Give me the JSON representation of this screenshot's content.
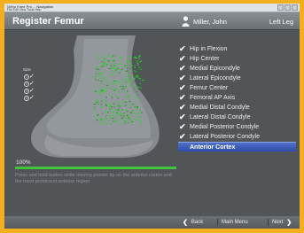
{
  "window": {
    "title": "Ortho Knee Pro ... Navigation",
    "menu": "File  Edit  View  Tools  Help"
  },
  "header": {
    "title": "Register Femur",
    "user": "Miller, John",
    "side": "Left Leg",
    "user_icon": "person-icon"
  },
  "size_panel": {
    "label": "Size",
    "items": [
      {
        "num": "1",
        "check": "✓"
      },
      {
        "num": "2",
        "check": "✓"
      },
      {
        "num": "3",
        "check": "✓"
      },
      {
        "num": "4",
        "check": "✓"
      }
    ]
  },
  "progress": {
    "label": "100%",
    "value": 100
  },
  "instructions": "Press and hold button while moving pointer tip on the anterior cortex and the most prominent anterior region.",
  "checklist": [
    {
      "label": "Hip in Flexion",
      "done": true
    },
    {
      "label": "Hip Center",
      "done": true
    },
    {
      "label": "Medial Epicondyle",
      "done": true
    },
    {
      "label": "Lateral Epicondyle",
      "done": true
    },
    {
      "label": "Femur Center",
      "done": true
    },
    {
      "label": "Femoral AP Axis",
      "done": true
    },
    {
      "label": "Medial Distal Condyle",
      "done": true
    },
    {
      "label": "Lateral Distal Condyle",
      "done": true
    },
    {
      "label": "Medial Posterior Condyle",
      "done": true
    },
    {
      "label": "Lateral Posterior Condyle",
      "done": true
    },
    {
      "label": "Anterior Cortex",
      "done": false,
      "active": true
    }
  ],
  "footer": {
    "back": "Back",
    "main_menu": "Main Menu",
    "next": "Next"
  },
  "colors": {
    "frame": "#f2b01e",
    "progress": "#3fc63b",
    "active_item": "#3b59b6",
    "points": "#2fd12f"
  }
}
